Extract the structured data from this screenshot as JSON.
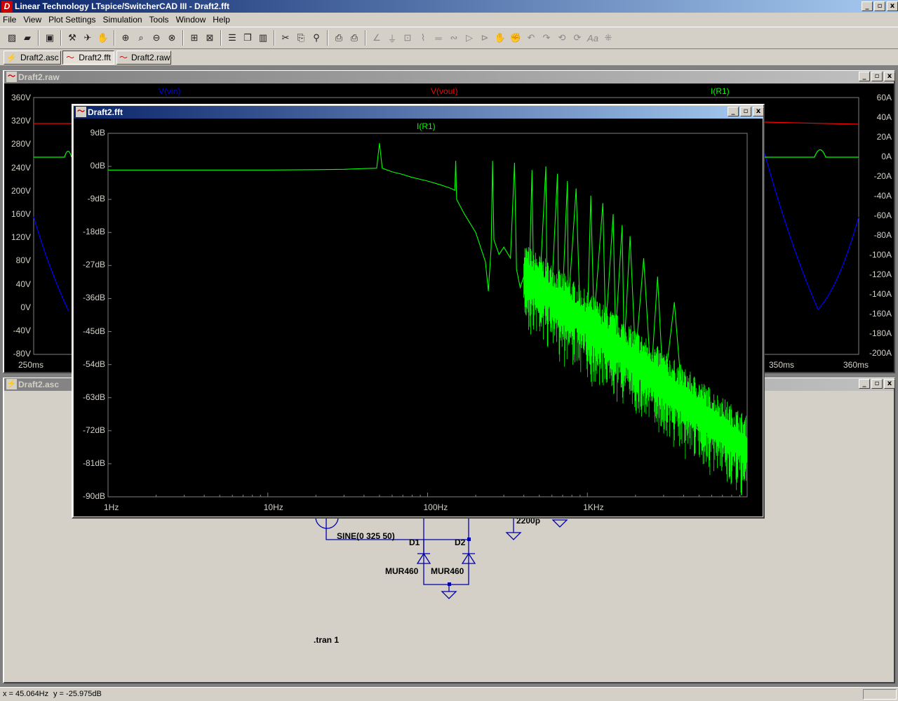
{
  "app": {
    "title": "Linear Technology LTspice/SwitcherCAD III - Draft2.fft",
    "icon_letter": "D",
    "caption_buttons": [
      "_",
      "▫",
      "x"
    ]
  },
  "menu": [
    "File",
    "View",
    "Plot Settings",
    "Simulation",
    "Tools",
    "Window",
    "Help"
  ],
  "toolbar_icons": [
    "new-schematic-icon",
    "open-icon",
    "save-icon",
    "control-panel-icon",
    "run-icon",
    "halt-icon",
    "pan-icon",
    "zoom-in-icon",
    "zoom-area-icon",
    "zoom-out-icon",
    "zoom-cancel-icon",
    "autorange-icon",
    "zoom-fit-icon",
    "tile-horizontal-icon",
    "cascade-icon",
    "tile-vertical-icon",
    "cut-icon",
    "copy-icon",
    "find-icon",
    "print-preview-icon",
    "print-icon",
    "wire-icon",
    "ground-icon",
    "label-icon",
    "resistor-icon",
    "capacitor-icon",
    "inductor-icon",
    "diode-icon",
    "component-icon",
    "move-icon",
    "drag-icon",
    "undo-icon",
    "redo-icon",
    "rotate-icon",
    "mirror-icon",
    "text-icon",
    "spice-directive-icon"
  ],
  "tabs": [
    {
      "label": "Draft2.asc",
      "icon": "schematic-icon"
    },
    {
      "label": "Draft2.fft",
      "icon": "waveform-icon"
    },
    {
      "label": "Draft2.raw",
      "icon": "waveform-icon"
    }
  ],
  "raw_window": {
    "title": "Draft2.raw",
    "traces": [
      {
        "name": "V(vin)",
        "color": "#0000ff"
      },
      {
        "name": "V(vout)",
        "color": "#ff0000"
      },
      {
        "name": "I(R1)",
        "color": "#00ff00"
      }
    ],
    "left_axis": [
      "360V",
      "320V",
      "280V",
      "240V",
      "200V",
      "160V",
      "120V",
      "80V",
      "40V",
      "0V",
      "-40V",
      "-80V"
    ],
    "right_axis": [
      "60A",
      "40A",
      "20A",
      "0A",
      "-20A",
      "-40A",
      "-60A",
      "-80A",
      "-100A",
      "-120A",
      "-140A",
      "-160A",
      "-180A",
      "-200A"
    ],
    "x_axis_visible": [
      "250ms",
      "350ms",
      "360ms"
    ]
  },
  "asc_window": {
    "title": "Draft2.asc",
    "components": {
      "source_value": "SINE(0 325 50)",
      "d1": "D1",
      "d2": "D2",
      "d1_model": "MUR460",
      "d2_model": "MUR460",
      "cap_value": "2200p",
      "directive": ".tran 1"
    }
  },
  "fft_window": {
    "title": "Draft2.fft",
    "trace_name": "I(R1)",
    "trace_color": "#00ff00"
  },
  "chart_data": [
    {
      "type": "line",
      "title": "",
      "series": [
        {
          "name": "I(R1)",
          "color": "#00ff00",
          "points_hz_db": [
            [
              1,
              -1
            ],
            [
              2,
              -1
            ],
            [
              5,
              -1
            ],
            [
              10,
              -1
            ],
            [
              20,
              -0.9
            ],
            [
              30,
              -0.8
            ],
            [
              40,
              -0.6
            ],
            [
              48,
              -0.5
            ],
            [
              50,
              6.3
            ],
            [
              52,
              -0.5
            ],
            [
              60,
              -1.5
            ],
            [
              70,
              -2.2
            ],
            [
              80,
              -3
            ],
            [
              100,
              -4
            ],
            [
              120,
              -5
            ],
            [
              140,
              -6
            ],
            [
              148,
              -6.5
            ],
            [
              150,
              1.5
            ],
            [
              152,
              -9
            ],
            [
              170,
              -13
            ],
            [
              200,
              -18
            ],
            [
              230,
              -26
            ],
            [
              240,
              -34
            ],
            [
              250,
              -22
            ],
            [
              255,
              1.5
            ],
            [
              260,
              -20
            ],
            [
              280,
              -24
            ],
            [
              300,
              -22
            ],
            [
              330,
              -25
            ],
            [
              350,
              1
            ],
            [
              360,
              -28
            ],
            [
              380,
              -33
            ],
            [
              400,
              -30
            ],
            [
              430,
              -35
            ],
            [
              450,
              -1
            ],
            [
              460,
              -30
            ],
            [
              500,
              -35
            ],
            [
              550,
              0
            ],
            [
              560,
              -36
            ],
            [
              600,
              -33
            ],
            [
              650,
              -2
            ],
            [
              660,
              -38
            ],
            [
              700,
              -35
            ],
            [
              750,
              -4
            ],
            [
              760,
              -38
            ],
            [
              850,
              -6
            ],
            [
              900,
              -40
            ],
            [
              1000,
              -43
            ],
            [
              1050,
              -8
            ],
            [
              1100,
              -42
            ],
            [
              1250,
              -10
            ],
            [
              1300,
              -45
            ],
            [
              1450,
              -13
            ],
            [
              1500,
              -46
            ],
            [
              1650,
              -16
            ],
            [
              1700,
              -50
            ],
            [
              1850,
              -19
            ],
            [
              2000,
              -52
            ],
            [
              2250,
              -25
            ],
            [
              2500,
              -58
            ],
            [
              2750,
              -30
            ],
            [
              3000,
              -62
            ],
            [
              3500,
              -37
            ],
            [
              4000,
              -68
            ],
            [
              5000,
              -72
            ],
            [
              6000,
              -74
            ],
            [
              7000,
              -75
            ],
            [
              8000,
              -75
            ],
            [
              10000,
              -76
            ]
          ]
        }
      ],
      "x_scale": "log",
      "x_tick_labels": [
        "1Hz",
        "10Hz",
        "100Hz",
        "1KHz"
      ],
      "x_range": [
        1,
        10000
      ],
      "y_tick_labels": [
        "9dB",
        "0dB",
        "-9dB",
        "-18dB",
        "-27dB",
        "-36dB",
        "-45dB",
        "-54dB",
        "-63dB",
        "-72dB",
        "-81dB",
        "-90dB"
      ],
      "y_range": [
        -90,
        9
      ],
      "legend": "top-center",
      "grid": false
    }
  ],
  "status": {
    "x_readout": "x = 45.064Hz",
    "y_readout": "y = -25.975dB"
  }
}
